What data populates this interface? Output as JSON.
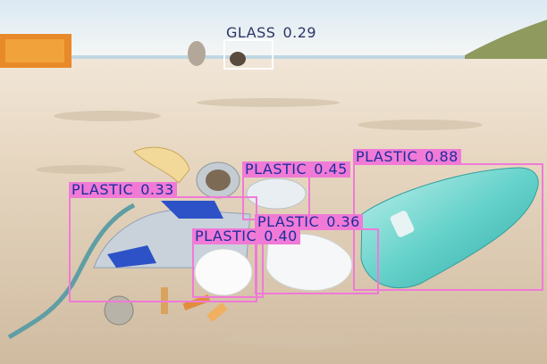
{
  "detections": [
    {
      "label": "GLASS",
      "score": "0.29",
      "kind": "glass"
    },
    {
      "label": "PLASTIC",
      "score": "0.88",
      "kind": "plastic"
    },
    {
      "label": "PLASTIC",
      "score": "0.45",
      "kind": "plastic"
    },
    {
      "label": "PLASTIC",
      "score": "0.33",
      "kind": "plastic"
    },
    {
      "label": "PLASTIC",
      "score": "0.36",
      "kind": "plastic"
    },
    {
      "label": "PLASTIC",
      "score": "0.40",
      "kind": "plastic"
    }
  ],
  "colors": {
    "plastic_box": "#f07ad6",
    "label_text": "#1c2f9c",
    "glass_box": "#ffffff",
    "glass_text": "#2b3566"
  }
}
